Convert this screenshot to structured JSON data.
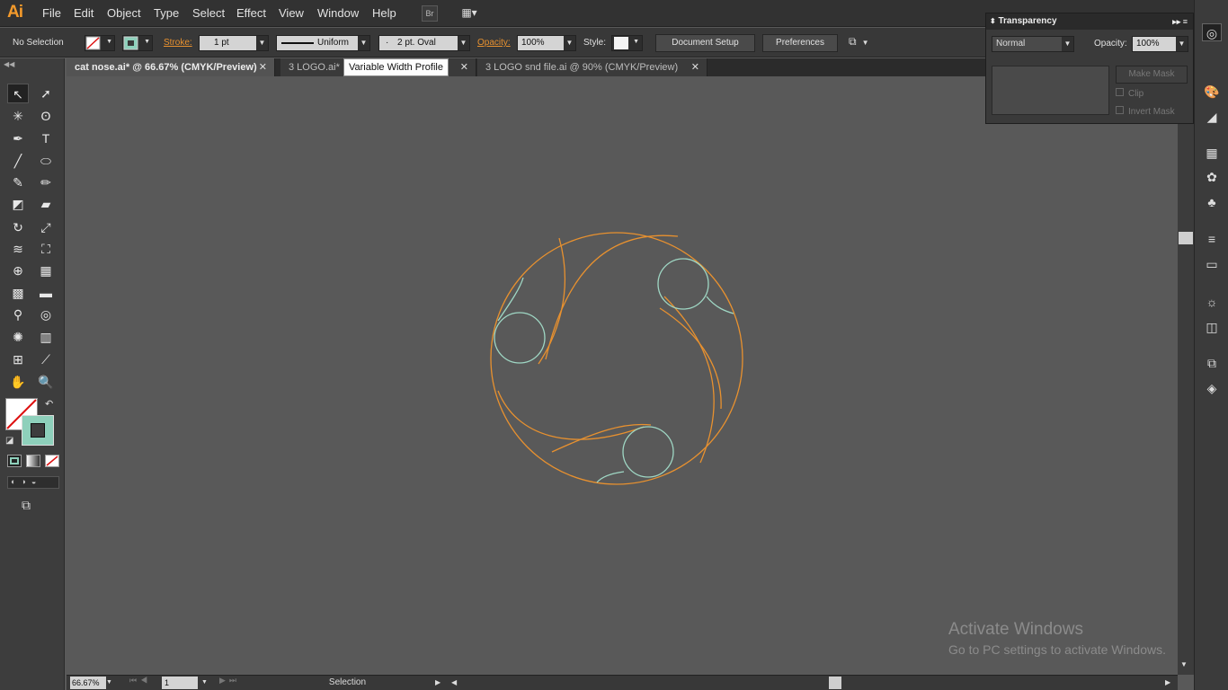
{
  "app": {
    "logo": "Ai"
  },
  "menu": [
    "File",
    "Edit",
    "Object",
    "Type",
    "Select",
    "Effect",
    "View",
    "Window",
    "Help"
  ],
  "menubar_buttons": {
    "bridge": "Br",
    "arrange": "▦▾"
  },
  "control": {
    "selection": "No Selection",
    "stroke_label": "Stroke:",
    "stroke_weight": "1 pt",
    "profile": "Uniform",
    "brush": "2 pt. Oval",
    "opacity_label": "Opacity:",
    "opacity": "100%",
    "style_label": "Style:",
    "document_setup": "Document Setup",
    "preferences": "Preferences"
  },
  "tabs": [
    {
      "label": "cat nose.ai* @ 66.67% (CMYK/Preview)",
      "close": "✕"
    },
    {
      "label": "3 LOGO.ai*",
      "close": "✕"
    },
    {
      "label": "3 LOGO snd file.ai @ 90% (CMYK/Preview)",
      "close": "✕"
    }
  ],
  "tooltip": "Variable Width Profile",
  "transparency": {
    "title": "Transparency",
    "blend_mode": "Normal",
    "opacity_label": "Opacity:",
    "opacity": "100%",
    "make_mask": "Make Mask",
    "clip": "Clip",
    "invert_mask": "Invert Mask"
  },
  "status": {
    "zoom": "66.67%",
    "page": "1",
    "tool": "Selection"
  },
  "watermark": {
    "line1": "Activate Windows",
    "line2": "Go to PC settings to activate Windows."
  },
  "colors": {
    "accent": "#f39a2b",
    "orange_path": "#e8912f",
    "teal_path": "#9fd7c4",
    "fill_swatch": "#8ed0bb"
  }
}
